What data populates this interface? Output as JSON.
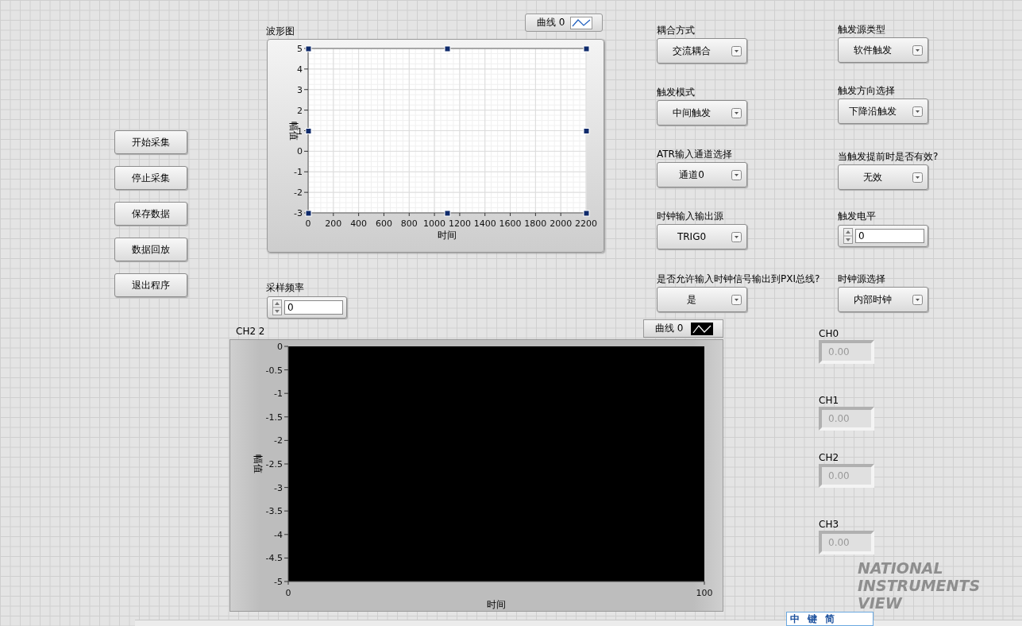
{
  "buttons": [
    "开始采集",
    "停止采集",
    "保存数据",
    "数据回放",
    "退出程序"
  ],
  "waveform_graph": {
    "label": "波形图",
    "legend": "曲线 0",
    "chart_data": {
      "type": "line",
      "grid": true,
      "xlabel": "时间",
      "ylabel": "幅值",
      "xlim": [
        0,
        2200
      ],
      "ylim": [
        -3,
        5
      ],
      "xticks": [
        0,
        200,
        400,
        600,
        800,
        1000,
        1200,
        1400,
        1600,
        1800,
        2000,
        2200
      ],
      "yticks": [
        -3,
        -2,
        -1,
        0,
        1,
        2,
        3,
        4,
        5
      ]
    }
  },
  "sample_rate": {
    "label": "采样频率",
    "value": "0"
  },
  "waveform_chart": {
    "label": "CH2 2",
    "legend": "曲线 0",
    "chart_data": {
      "type": "line",
      "xlabel": "时间",
      "ylabel": "幅值",
      "xlim": [
        0,
        100
      ],
      "ylim": [
        -5,
        0
      ],
      "xticks": [
        0,
        100
      ],
      "yticks": [
        0,
        -0.5,
        -1,
        -1.5,
        -2,
        -2.5,
        -3,
        -3.5,
        -4,
        -4.5,
        -5
      ]
    }
  },
  "settings_left": [
    {
      "label": "耦合方式",
      "kind": "ring",
      "value": "交流耦合"
    },
    {
      "label": "触发模式",
      "kind": "ring",
      "value": "中间触发"
    },
    {
      "label": "ATR输入通道选择",
      "kind": "ring",
      "value": "通道0"
    },
    {
      "label": "时钟输入输出源",
      "kind": "ring",
      "value": "TRIG0"
    },
    {
      "label": "是否允许输入时钟信号输出到PXI总线?",
      "kind": "ring",
      "value": "是"
    }
  ],
  "settings_right": [
    {
      "label": "触发源类型",
      "kind": "ring",
      "value": "软件触发"
    },
    {
      "label": "触发方向选择",
      "kind": "ring",
      "value": "下降沿触发"
    },
    {
      "label": "当触发提前时是否有效?",
      "kind": "ring",
      "value": "无效"
    },
    {
      "label": "触发电平",
      "kind": "numeric",
      "value": "0"
    },
    {
      "label": "时钟源选择",
      "kind": "ring",
      "value": "内部时钟"
    }
  ],
  "channels": [
    {
      "label": "CH0",
      "value": "0.00",
      "disabled": true
    },
    {
      "label": "CH1",
      "value": "0.00",
      "disabled": true
    },
    {
      "label": "CH2",
      "value": "0.00",
      "disabled": true
    },
    {
      "label": "CH3",
      "value": "0.00",
      "disabled": true
    }
  ],
  "logo": [
    "NATIONAL",
    "INSTRUMENTS",
    "VIEW"
  ],
  "ime_bar": [
    "中",
    "键",
    "简"
  ]
}
